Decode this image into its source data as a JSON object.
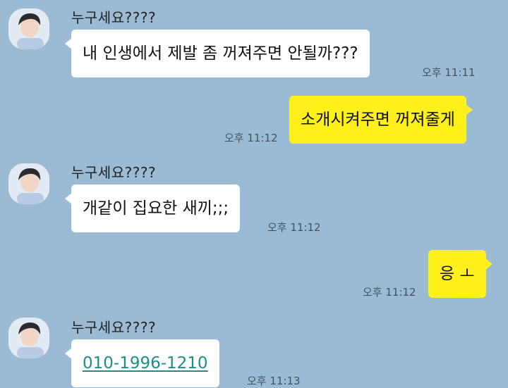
{
  "messages": [
    {
      "side": "left",
      "sender": "누구세요????",
      "text": "내 인생에서 제발 좀 꺼져주면 안될까???",
      "time": "오후 11:11"
    },
    {
      "side": "right",
      "text": "소개시켜주면 꺼져줄게",
      "time": "오후 11:12"
    },
    {
      "side": "left",
      "sender": "누구세요????",
      "text": "개같이 집요한 새끼;;;",
      "time": "오후 11:12"
    },
    {
      "side": "right",
      "text": "응 ㅗ",
      "time": "오후 11:12"
    },
    {
      "side": "left",
      "sender": "누구세요????",
      "text": "010-1996-1210",
      "link": true,
      "time": "오후 11:13"
    }
  ],
  "colors": {
    "background": "#9bbbd4",
    "my_bubble": "#fef01b",
    "their_bubble": "#ffffff",
    "link": "#1f8f86"
  }
}
